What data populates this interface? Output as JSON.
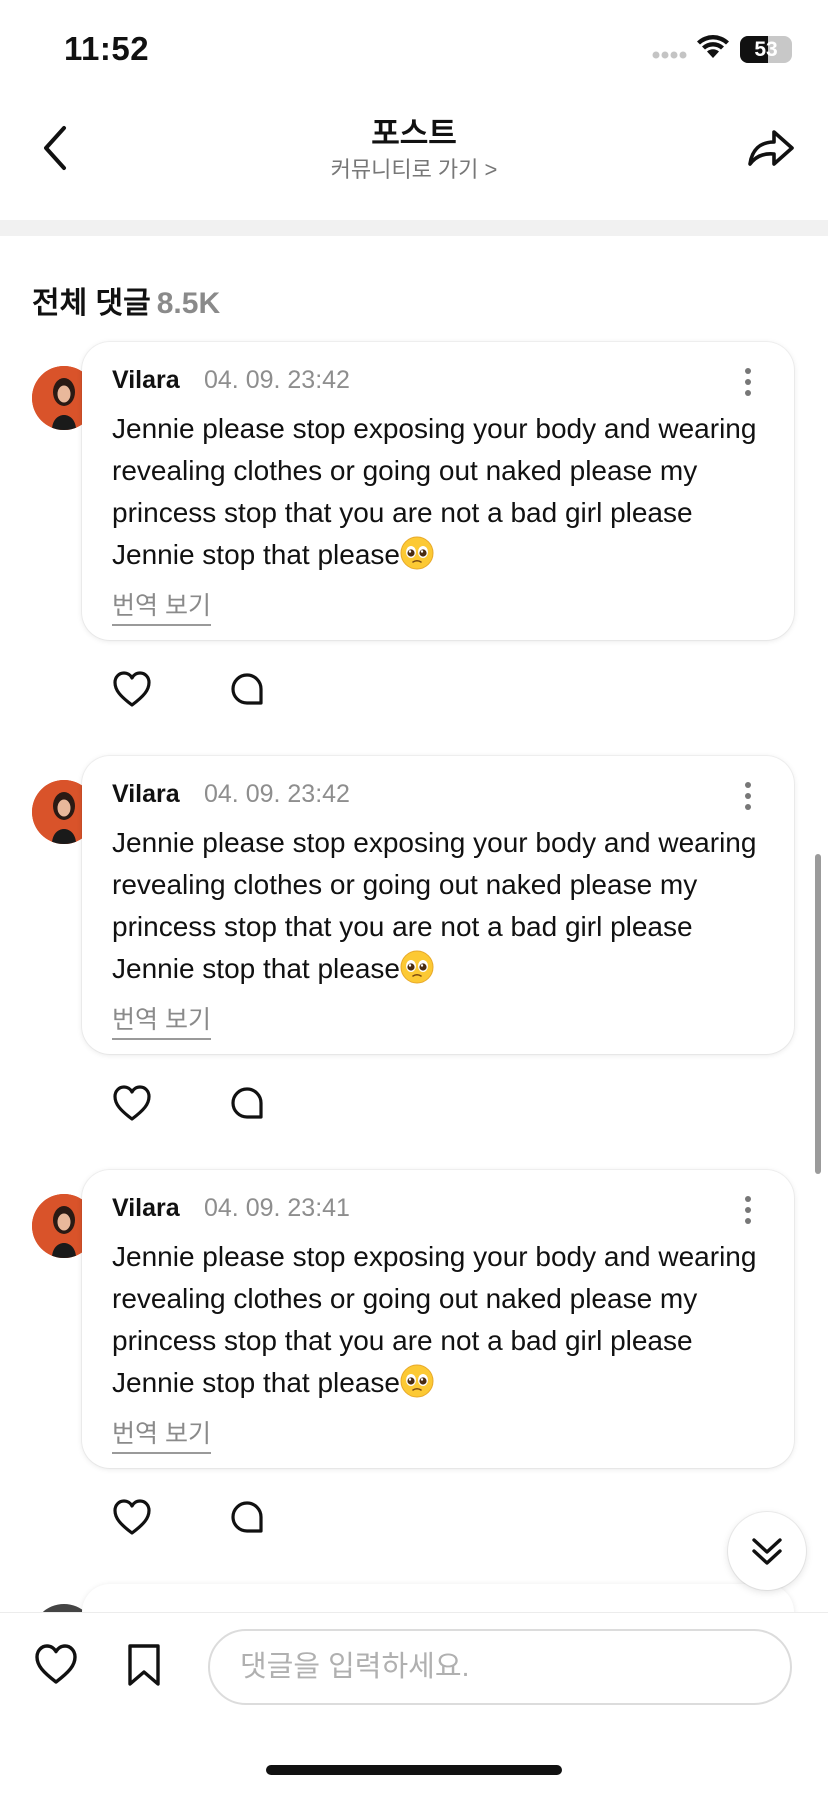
{
  "status_bar": {
    "time": "11:52",
    "battery": "53",
    "battery_level": 0.53
  },
  "header": {
    "title": "포스트",
    "subtitle": "커뮤니티로 가기 >"
  },
  "comments_section": {
    "title": "전체 댓글",
    "count": "8.5K"
  },
  "comments": [
    {
      "author": "Vilara",
      "date": "04. 09. 23:42",
      "text": "Jennie please stop exposing your body and wearing revealing clothes or going out naked please my princess stop that you are not a bad girl please Jennie stop that please",
      "emoji_icon": "pleading-face-emoji",
      "translate_label": "번역 보기"
    },
    {
      "author": "Vilara",
      "date": "04. 09. 23:42",
      "text": "Jennie please stop exposing your body and wearing revealing clothes or going out naked please my princess stop that you are not a bad girl please Jennie stop that please",
      "emoji_icon": "pleading-face-emoji",
      "translate_label": "번역 보기"
    },
    {
      "author": "Vilara",
      "date": "04. 09. 23:41",
      "text": "Jennie please stop exposing your body and wearing revealing clothes or going out naked please my princess stop that you are not a bad girl please Jennie stop that please",
      "emoji_icon": "pleading-face-emoji",
      "translate_label": "번역 보기"
    }
  ],
  "bottom_bar": {
    "comment_placeholder": "댓글을 입력하세요."
  },
  "icons": {
    "back": "chevron-left-icon",
    "share": "share-arrow-icon",
    "more": "more-vertical-icon",
    "like": "heart-icon",
    "reply": "speech-bubble-icon",
    "jump": "chevron-double-down-icon",
    "bookmark": "bookmark-icon"
  },
  "colors": {
    "avatar_bg": "#d9532a",
    "muted_text": "#8e8e8e"
  }
}
